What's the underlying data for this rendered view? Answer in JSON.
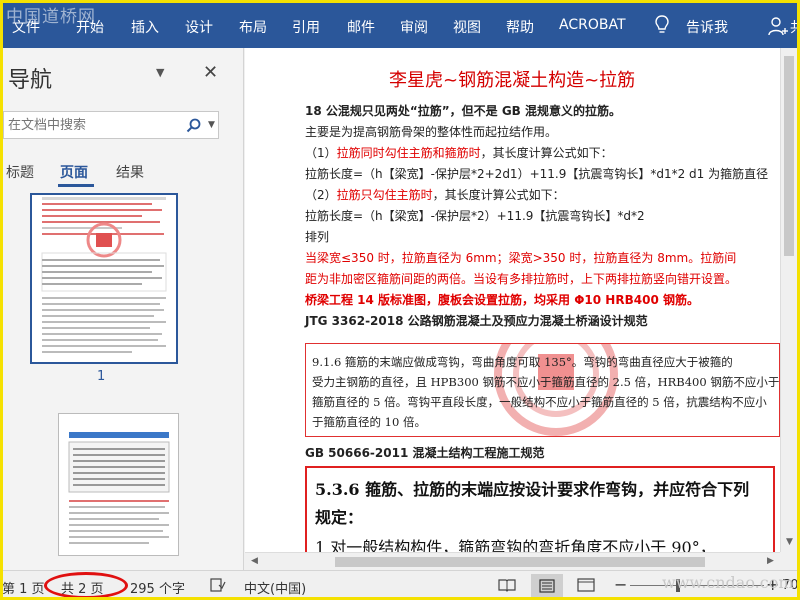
{
  "ribbon": {
    "watermark": "中国道桥网",
    "tabs": [
      "文件",
      "开始",
      "插入",
      "设计",
      "布局",
      "引用",
      "邮件",
      "审阅",
      "视图",
      "帮助",
      "ACROBAT"
    ],
    "tell_me": "告诉我",
    "share": "共"
  },
  "nav": {
    "title": "导航",
    "search_placeholder": "在文档中搜索",
    "tabs": [
      "标题",
      "页面",
      "结果"
    ],
    "active_tab": "页面",
    "page_numbers": [
      "1"
    ]
  },
  "doc": {
    "title": "李星虎~钢筋混凝土构造~拉筋",
    "lines": [
      "18 公混规只见两处“拉筋”，但不是 GB 混规意义的拉筋。",
      "主要是为提高钢筋骨架的整体性而起拉结作用。",
      "（1）",
      "拉筋同时勾住主筋和箍筋时",
      "，其长度计算公式如下：",
      "拉筋长度=（h【梁宽】-保护层*2+2d1）+11.9【抗震弯钩长】*d1*2 d1 为箍筋直径",
      "（2）",
      "拉筋只勾住主筋时",
      "，其长度计算公式如下：",
      "拉筋长度=（h【梁宽】-保护层*2）+11.9【抗震弯钩长】*d*2",
      "排列",
      "当梁宽≤350 时，拉筋直径为 6mm；梁宽>350 时，拉筋直径为 8mm。拉筋间",
      "距为非加密区箍筋间距的两倍。当设有多排拉筋时，上下两排拉筋竖向错开设置。",
      "桥梁工程 14 版标准图，腹板会设置拉筋，均采用 Φ10 HRB400 钢筋。",
      "JTG 3362-2018 公路钢筋混凝土及预应力混凝土桥涵设计规范",
      "GB 50666-2011 混凝土结构工程施工规范"
    ],
    "img1_lines": [
      "9.1.6  箍筋的末端应做成弯钩，弯曲角度可取 135°。弯钩的弯曲直径应大于被箍的",
      "受力主钢筋的直径，且 HPB300 钢筋不应小于箍筋直径的 2.5 倍，HRB400 钢筋不应小于",
      "箍筋直径的 5 倍。弯钩平直段长度，一般结构不应小于箍筋直径的 5 倍，抗震结构不应小",
      "于箍筋直径的 10 倍。"
    ],
    "img2_lines": [
      "5.3.6  箍筋、拉筋的末端应按设计要求作弯钩，并应符合下列",
      "规定：",
      "    1  对一般结构构件，箍筋弯钩的弯折角度不应小于 90°，"
    ]
  },
  "status": {
    "page": "第 1 页",
    "total": "共 2 页",
    "words": "295 个字",
    "language": "中文(中国)",
    "watermark": "www.cndao.com",
    "zoom": "70"
  },
  "colors": {
    "ribbon": "#2b579a",
    "accent": "#2b579a",
    "red": "#e00000",
    "frame": "#f5e100"
  }
}
